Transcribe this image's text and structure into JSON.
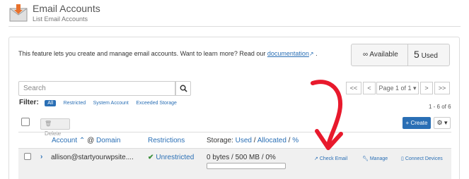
{
  "header": {
    "title": "Email Accounts",
    "subtitle": "List Email Accounts",
    "logo_icon": "email-download-icon"
  },
  "intro": {
    "text": "This feature lets you create and manage email accounts. Want to learn more? Read our",
    "link_label": "documentation",
    "suffix": "."
  },
  "stats": {
    "available_symbol": "∞",
    "available_label": "Available",
    "used_count": "5",
    "used_label": "Used"
  },
  "search": {
    "placeholder": "Search"
  },
  "filter": {
    "label": "Filter:",
    "items": [
      "All",
      "Restricted",
      "System Account",
      "Exceeded Storage"
    ],
    "active": "All"
  },
  "pagination": {
    "first": "<<",
    "prev": "<",
    "page_label": "Page 1 of 1 ▾",
    "next": ">",
    "last": ">>",
    "count_label": "1 - 6 of 6"
  },
  "toolbar": {
    "delete_label": "Delete",
    "create_label": "+ Create",
    "settings_label": "⚙ ▾"
  },
  "table": {
    "columns": {
      "account": "Account",
      "sort_arrow": "⌃",
      "at": "@",
      "domain": "Domain",
      "restrictions": "Restrictions",
      "storage_prefix": "Storage:",
      "storage_used": "Used",
      "storage_sep1": "/",
      "storage_allocated": "Allocated",
      "storage_sep2": "/",
      "storage_pct": "%"
    },
    "rows": [
      {
        "account": "allison@startyourwpsite....",
        "restriction": "Unrestricted",
        "storage": "0 bytes / 500 MB / 0%",
        "storage_fraction": 0,
        "actions": {
          "check_email": "Check Email",
          "manage": "Manage",
          "connect_devices": "Connect Devices"
        }
      }
    ]
  },
  "colors": {
    "accent": "#2a6fb5",
    "annotation": "#e8192c"
  }
}
